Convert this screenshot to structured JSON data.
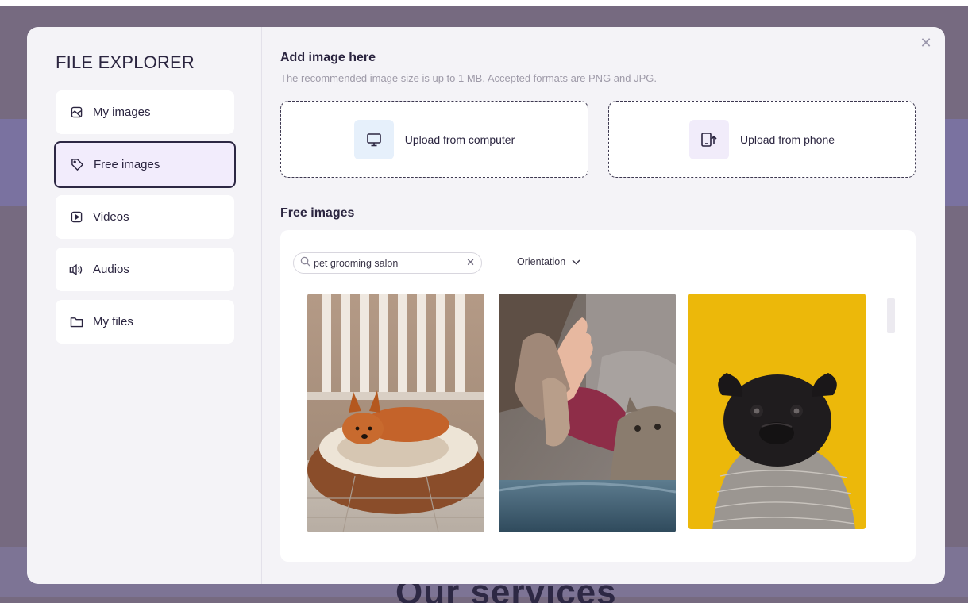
{
  "background": {
    "heading": "Our services"
  },
  "modal": {
    "close_icon": "close-icon",
    "sidebar": {
      "title": "FILE EXPLORER",
      "items": [
        {
          "label": "My images",
          "icon": "image-icon",
          "active": false
        },
        {
          "label": "Free images",
          "icon": "tag-icon",
          "active": true
        },
        {
          "label": "Videos",
          "icon": "video-icon",
          "active": false
        },
        {
          "label": "Audios",
          "icon": "speaker-icon",
          "active": false
        },
        {
          "label": "My files",
          "icon": "folder-icon",
          "active": false
        }
      ]
    },
    "upload": {
      "title": "Add image here",
      "subtitle": "The recommended image size is up to 1 MB. Accepted formats are PNG and JPG.",
      "computer_label": "Upload from computer",
      "phone_label": "Upload from phone"
    },
    "free_images": {
      "title": "Free images",
      "search_value": "pet grooming salon",
      "orientation_label": "Orientation"
    }
  },
  "colors": {
    "accent": "#2d2844",
    "active_bg": "#f2ecfc",
    "overlay": "#766a80"
  }
}
